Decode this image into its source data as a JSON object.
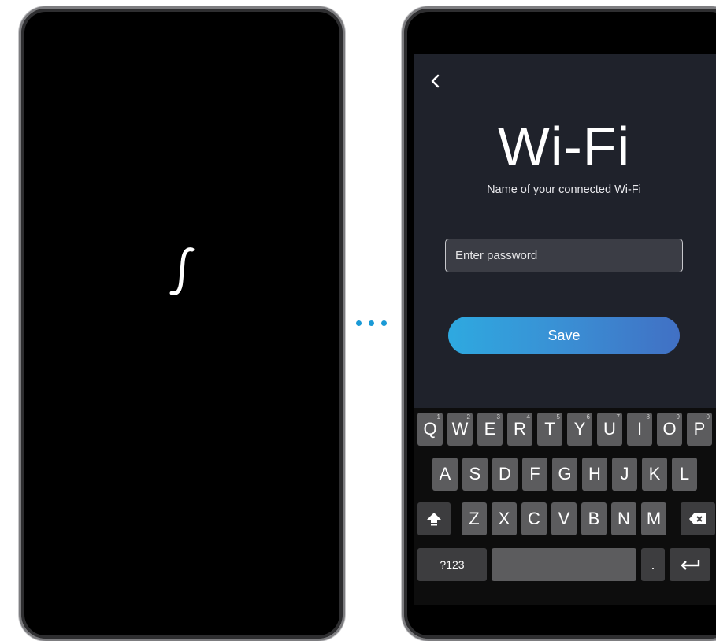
{
  "colors": {
    "dots": "#1a9ad6",
    "screen_bg": "#1f222b",
    "save_gradient_start": "#2ea9e0",
    "save_gradient_end": "#4170c4",
    "key_bg": "#5c5c5e"
  },
  "left_screen": {
    "logo_icon": "integral-s-logo-icon"
  },
  "transition": {
    "icon": "ellipsis-dots-icon"
  },
  "wifi_screen": {
    "back_icon": "chevron-left-icon",
    "title": "Wi-Fi",
    "subtitle": "Name of your connected Wi-Fi",
    "password": {
      "value": "",
      "placeholder": "Enter password"
    },
    "save_label": "Save"
  },
  "keyboard": {
    "row1": [
      {
        "label": "Q",
        "hint": "1"
      },
      {
        "label": "W",
        "hint": "2"
      },
      {
        "label": "E",
        "hint": "3"
      },
      {
        "label": "R",
        "hint": "4"
      },
      {
        "label": "T",
        "hint": "5"
      },
      {
        "label": "Y",
        "hint": "6"
      },
      {
        "label": "U",
        "hint": "7"
      },
      {
        "label": "I",
        "hint": "8"
      },
      {
        "label": "O",
        "hint": "9"
      },
      {
        "label": "P",
        "hint": "0"
      }
    ],
    "row2": [
      "A",
      "S",
      "D",
      "F",
      "G",
      "H",
      "J",
      "K",
      "L"
    ],
    "row3": [
      "Z",
      "X",
      "C",
      "V",
      "B",
      "N",
      "M"
    ],
    "shift_icon": "shift-arrow-icon",
    "backspace_icon": "backspace-icon",
    "symbols_label": "?123",
    "period_label": ".",
    "enter_icon": "enter-return-icon"
  }
}
